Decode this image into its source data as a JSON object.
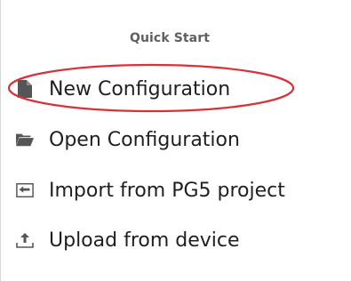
{
  "panel": {
    "title": "Quick Start"
  },
  "items": [
    {
      "label": "New Configuration",
      "icon": "document-icon"
    },
    {
      "label": "Open Configuration",
      "icon": "folder-open-icon"
    },
    {
      "label": "Import from PG5 project",
      "icon": "import-icon"
    },
    {
      "label": "Upload from device",
      "icon": "upload-icon"
    }
  ],
  "annotation": {
    "highlight_color": "#d9303a"
  },
  "colors": {
    "icon": "#555555",
    "text": "#1f1f1f",
    "title": "#5f5f5f"
  }
}
